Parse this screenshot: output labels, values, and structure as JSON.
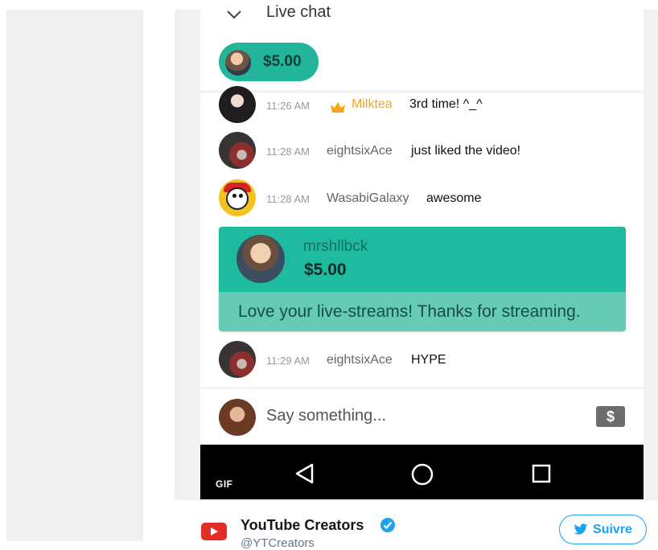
{
  "header": {
    "title": "Live chat",
    "pinned_superchat_amount": "$5.00"
  },
  "messages": [
    {
      "time": "11:26 AM",
      "author": "Milktea",
      "text": "3rd time! ^_^",
      "badge": "crown-icon"
    },
    {
      "time": "11:28 AM",
      "author": "eightsixAce",
      "text": "just liked the video!"
    },
    {
      "time": "11:28 AM",
      "author": "WasabiGalaxy",
      "text": "awesome"
    },
    {
      "time": "11:29 AM",
      "author": "eightsixAce",
      "text": "HYPE"
    }
  ],
  "superchat": {
    "author": "mrshllbck",
    "amount": "$5.00",
    "text": "Love your live-streams! Thanks for streaming."
  },
  "input": {
    "placeholder": "Say something...",
    "dollar_icon": "dollar-icon"
  },
  "navbar": {
    "gif_label": "GIF",
    "icons": [
      "back-icon",
      "home-icon",
      "recents-icon"
    ]
  },
  "tweet_footer": {
    "account_name": "YouTube Creators",
    "handle": "@YTCreators",
    "follow_label": "Suivre"
  },
  "colors": {
    "superchat_top": "#1ebba0",
    "superchat_bottom": "#66cbb6",
    "pill": "#23b59b",
    "gold_author": "#f4a71a",
    "twitter_blue": "#1da1f2",
    "youtube_red": "#e52d27"
  }
}
